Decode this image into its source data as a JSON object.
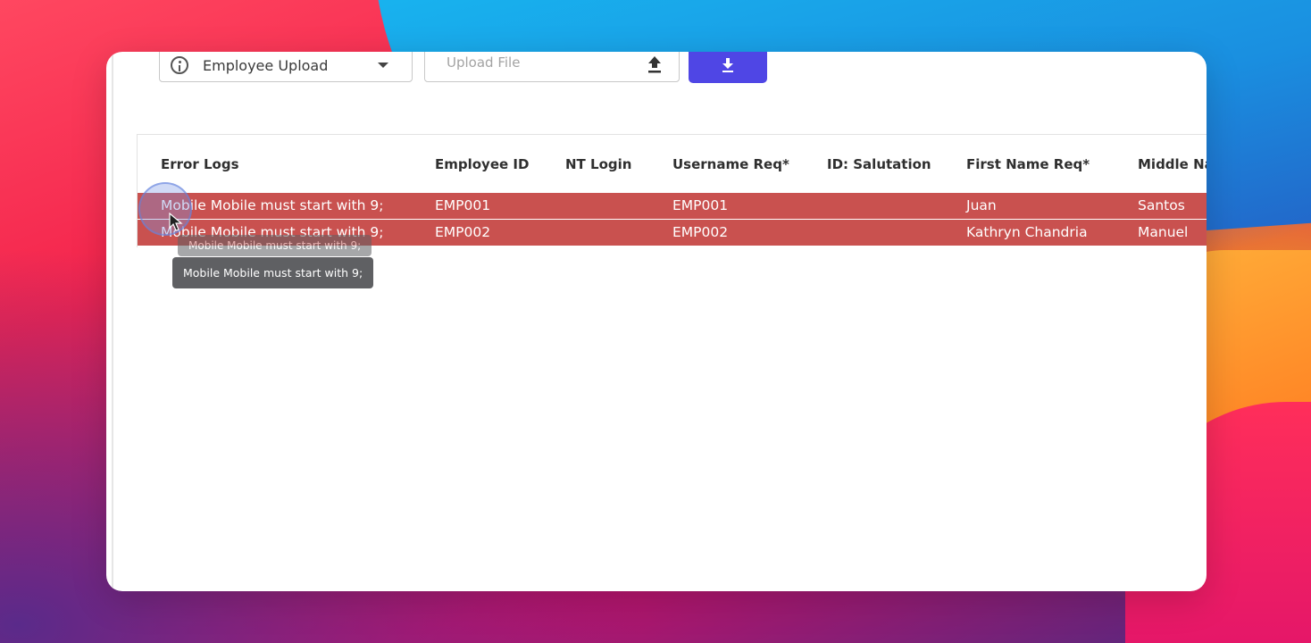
{
  "toolbar": {
    "upload_type": "Employee Upload",
    "upload_placeholder": "Upload File"
  },
  "icons": {
    "info": "info-circle-icon",
    "caret": "caret-down-icon",
    "upload": "upload-icon",
    "download": "download-icon"
  },
  "colors": {
    "error_row": "#c9514f",
    "download_button": "#4f46e5",
    "tooltip": "#5f6063"
  },
  "table": {
    "headers": [
      "Error Logs",
      "Employee ID",
      "NT Login",
      "Username Req*",
      "ID: Salutation",
      "First Name Req*",
      "Middle Na"
    ],
    "rows": [
      [
        "Mobile Mobile must start with 9;",
        "EMP001",
        "",
        "EMP001",
        "",
        "Juan",
        "Santos"
      ],
      [
        "Mobile Mobile must start with 9;",
        "EMP002",
        "",
        "EMP002",
        "",
        "Kathryn Chandria",
        "Manuel"
      ]
    ]
  },
  "tooltips": [
    "Mobile Mobile must start with 9;",
    "Mobile Mobile must start with 9;"
  ]
}
